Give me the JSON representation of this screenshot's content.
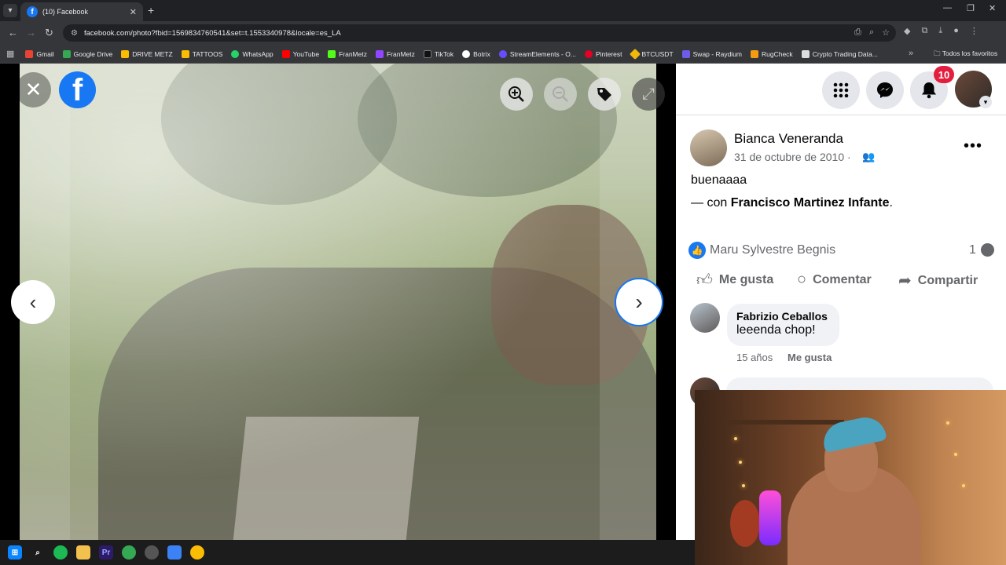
{
  "browser": {
    "tab_title": "(10) Facebook",
    "tab_close": "✕",
    "new_tab": "+",
    "url": "facebook.com/photo?fbid=1569834760541&set=t.1553340978&locale=es_LA"
  },
  "bookmarks": {
    "items": [
      {
        "label": "Gmail",
        "color": "#ea4335"
      },
      {
        "label": "Google Drive",
        "color": "#34a853"
      },
      {
        "label": "DRIVE METZ",
        "color": "#fbbc04"
      },
      {
        "label": "TATTOOS",
        "color": "#fbbc04"
      },
      {
        "label": "WhatsApp",
        "color": "#25d366"
      },
      {
        "label": "YouTube",
        "color": "#ff0000"
      },
      {
        "label": "FranMetz",
        "color": "#53fc18"
      },
      {
        "label": "FranMetz",
        "color": "#9146ff"
      },
      {
        "label": "TikTok",
        "color": "#111111"
      },
      {
        "label": "Botrix",
        "color": "#ffffff"
      },
      {
        "label": "StreamElements - O...",
        "color": "#6a4cff"
      },
      {
        "label": "Pinterest",
        "color": "#e60023"
      },
      {
        "label": "BTCUSDT",
        "color": "#f0b90b"
      },
      {
        "label": "Swap - Raydium",
        "color": "#6c5ce7"
      },
      {
        "label": "RugCheck",
        "color": "#f39c12"
      },
      {
        "label": "Crypto Trading Data...",
        "color": "#dddddd"
      }
    ],
    "all_favorites": "Todos los favoritos"
  },
  "post": {
    "author": "Bianca Veneranda",
    "date": "31 de octubre de 2010 ·",
    "text": "buenaaaa",
    "with_prefix": "— con ",
    "with_name": "Francisco Martinez Infante",
    "with_suffix": ".",
    "liker": "Maru Sylvestre Begnis",
    "comment_count": "1",
    "actions": {
      "like": "Me gusta",
      "comment": "Comentar",
      "share": "Compartir"
    }
  },
  "notifications": {
    "count": "10"
  },
  "comments": [
    {
      "author": "Fabrizio Ceballos",
      "text": "leeenda chop!",
      "age": "15 años",
      "like": "Me gusta"
    }
  ],
  "icons": {
    "close": "close-icon",
    "facebook_logo": "facebook-logo",
    "zoom_in": "zoom-in-icon",
    "zoom_out": "zoom-out-icon",
    "tag": "tag-icon",
    "fullscreen": "fullscreen-icon",
    "prev": "chevron-left-icon",
    "next": "chevron-right-icon",
    "menu": "grid-icon",
    "messenger": "messenger-icon",
    "bell": "bell-icon"
  },
  "colors": {
    "brand": "#1877f2",
    "badge": "#e41e3f",
    "secondary_text": "#65676b"
  }
}
